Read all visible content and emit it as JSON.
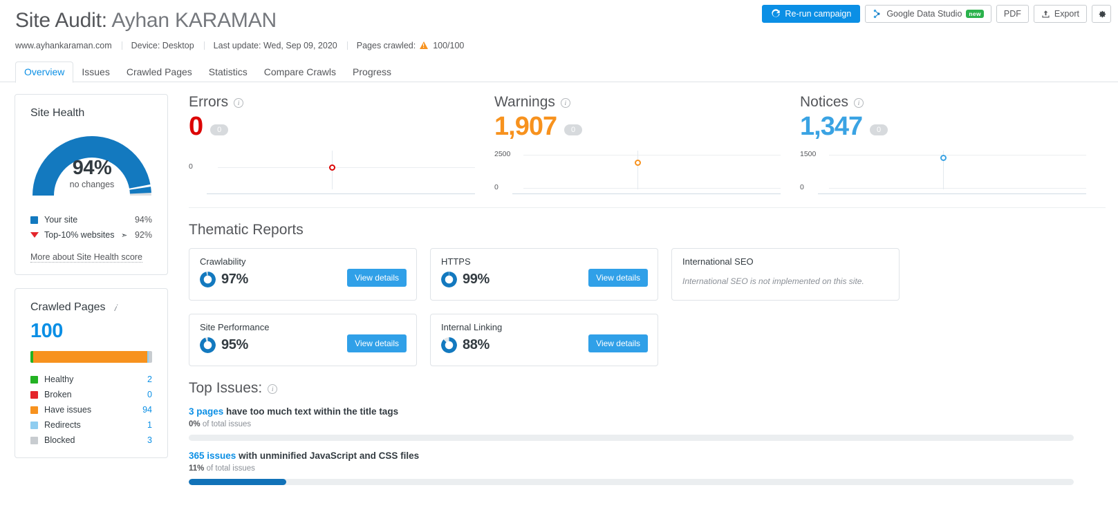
{
  "header": {
    "title_prefix": "Site Audit:",
    "title_name": "Ayhan KARAMAN",
    "meta": {
      "domain": "www.ayhankaraman.com",
      "device": "Device: Desktop",
      "last_update": "Last update: Wed, Sep 09, 2020",
      "pages_crawled_label": "Pages crawled:",
      "pages_crawled_value": "100/100"
    }
  },
  "toolbar": {
    "rerun_label": "Re-run campaign",
    "gds_label": "Google Data Studio",
    "gds_badge": "new",
    "pdf_label": "PDF",
    "export_label": "Export",
    "settings_title": "Settings"
  },
  "tabs": [
    {
      "label": "Overview",
      "active": true
    },
    {
      "label": "Issues",
      "active": false
    },
    {
      "label": "Crawled Pages",
      "active": false
    },
    {
      "label": "Statistics",
      "active": false
    },
    {
      "label": "Compare Crawls",
      "active": false
    },
    {
      "label": "Progress",
      "active": false
    }
  ],
  "site_health": {
    "title": "Site Health",
    "percent_text": "94%",
    "change_text": "no changes",
    "your_site_label": "Your site",
    "your_site_value": "94%",
    "top10_label": "Top-10% websites",
    "top10_value": "92%",
    "more_link": "More about Site Health score",
    "your_site_pct": 94,
    "top10_pct": 92,
    "color_primary": "#1379bf",
    "color_track": "#dcdfe2",
    "color_marker": "#e4252b"
  },
  "crawled_pages": {
    "title": "Crawled Pages",
    "total": "100",
    "rows": [
      {
        "label": "Healthy",
        "value": "2",
        "count": 2,
        "color": "#23b223"
      },
      {
        "label": "Broken",
        "value": "0",
        "count": 0,
        "color": "#e4252b"
      },
      {
        "label": "Have issues",
        "value": "94",
        "count": 94,
        "color": "#f7921e"
      },
      {
        "label": "Redirects",
        "value": "1",
        "count": 1,
        "color": "#8fcdf0"
      },
      {
        "label": "Blocked",
        "value": "3",
        "count": 3,
        "color": "#c8ccd0"
      }
    ]
  },
  "metrics": [
    {
      "label": "Errors",
      "value": "0",
      "delta": "0",
      "color": "#dc0505",
      "axis_top_label": "",
      "axis_bottom_label": "0",
      "marker_ratio": 0.0
    },
    {
      "label": "Warnings",
      "value": "1,907",
      "delta": "0",
      "color": "#f7921e",
      "axis_top_label": "2500",
      "axis_bottom_label": "0",
      "marker_ratio": 0.763
    },
    {
      "label": "Notices",
      "value": "1,347",
      "delta": "0",
      "color": "#3aa3e3",
      "axis_top_label": "1500",
      "axis_bottom_label": "0",
      "marker_ratio": 0.898
    }
  ],
  "thematic": {
    "title": "Thematic Reports",
    "view_details_label": "View details",
    "cards": [
      {
        "name": "Crawlability",
        "percent_text": "97%",
        "percent": 97,
        "empty": false
      },
      {
        "name": "HTTPS",
        "percent_text": "99%",
        "percent": 99,
        "empty": false
      },
      {
        "name": "International SEO",
        "percent_text": "",
        "percent": 0,
        "empty": true,
        "empty_text": "International SEO is not implemented on this site."
      },
      {
        "name": "Site Performance",
        "percent_text": "95%",
        "percent": 95,
        "empty": false
      },
      {
        "name": "Internal Linking",
        "percent_text": "88%",
        "percent": 88,
        "empty": false
      }
    ]
  },
  "top_issues": {
    "title": "Top Issues:",
    "of_total_suffix": "of total issues",
    "items": [
      {
        "link": "3 pages",
        "rest": "have too much text within the title tags",
        "pct_text": "0%",
        "pct": 0
      },
      {
        "link": "365 issues",
        "rest": "with unminified JavaScript and CSS files",
        "pct_text": "11%",
        "pct": 11
      },
      {
        "link": "",
        "rest": "",
        "pct_text": "",
        "pct": 0
      }
    ]
  }
}
